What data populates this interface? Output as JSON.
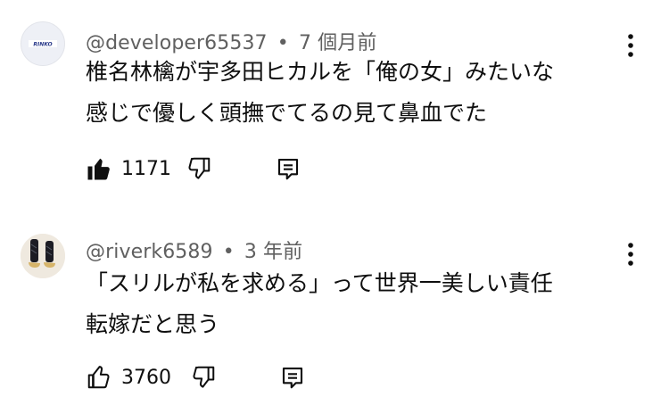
{
  "comments": [
    {
      "author": "@developer65537",
      "separator": "•",
      "time": "7 個月前",
      "text_line1": "椎名林檎が宇多田ヒカルを「俺の女」みたいな",
      "text_line2": "感じで優しく頭撫でてるの見て鼻血でた",
      "likes": "1171",
      "liked": true,
      "avatar_text": "RINKO"
    },
    {
      "author": "@riverk6589",
      "separator": "•",
      "time": "3 年前",
      "text_line1": "「スリルが私を求める」って世界一美しい責任",
      "text_line2": "転嫁だと思う",
      "likes": "3760",
      "liked": false
    }
  ],
  "colors": {
    "primary_text": "#0f0f0f",
    "secondary_text": "#606060",
    "background": "#ffffff"
  },
  "icons": [
    "like-icon",
    "dislike-icon",
    "reply-icon",
    "more-vertical-icon"
  ]
}
